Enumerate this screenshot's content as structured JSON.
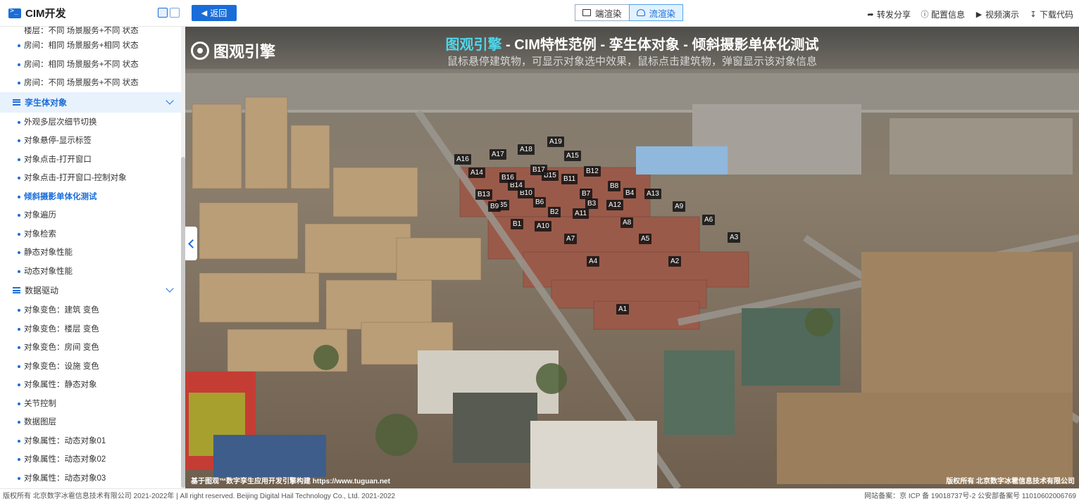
{
  "app": {
    "title": "CIM开发"
  },
  "header": {
    "back_label": "返回",
    "render_modes": [
      {
        "label": "端渲染",
        "icon": "monitor-icon",
        "active": false
      },
      {
        "label": "流渲染",
        "icon": "cloud-icon",
        "active": true
      }
    ],
    "tools": [
      {
        "label": "转发分享",
        "icon": "share-icon"
      },
      {
        "label": "配置信息",
        "icon": "info-icon"
      },
      {
        "label": "视频演示",
        "icon": "play-icon"
      },
      {
        "label": "下载代码",
        "icon": "download-icon"
      }
    ]
  },
  "sidebar": {
    "truncated_top": "楼层：不同 场景服务+不同 状态",
    "items_top": [
      "房间：相同 场景服务+相同 状态",
      "房间：相同 场景服务+不同 状态",
      "房间：不同 场景服务+不同 状态"
    ],
    "group1": {
      "label": "孪生体对象",
      "items": [
        "外观多层次细节切换",
        "对象悬停-显示标签",
        "对象点击-打开窗口",
        "对象点击-打开窗口-控制对象",
        "倾斜摄影单体化测试",
        "对象遍历",
        "对象检索",
        "静态对象性能",
        "动态对象性能"
      ],
      "active_index": 4
    },
    "group2": {
      "label": "数据驱动",
      "items": [
        "对象变色：建筑 变色",
        "对象变色：楼层 变色",
        "对象变色：房间 变色",
        "对象变色：设施 变色",
        "对象属性：静态对象",
        "关节控制",
        "数据图层",
        "对象属性：动态对象01",
        "对象属性：动态对象02",
        "对象属性：动态对象03"
      ]
    }
  },
  "viewport": {
    "logo_text": "图观引擎",
    "title_highlight": "图观引擎",
    "title_rest": " - CIM特性范例 - 孪生体对象 - 倾斜摄影单体化测试",
    "subtitle": "鼠标悬停建筑物，可显示对象选中效果，鼠标点击建筑物，弹窗显示该对象信息",
    "credit_left": "基于图观™数字孪生应用开发引擎构建 https://www.tuguan.net",
    "credit_right": "版权所有 北京数字冰雹信息技术有限公司",
    "building_labels": [
      "A1",
      "A2",
      "A3",
      "A4",
      "A5",
      "A6",
      "A7",
      "A8",
      "A9",
      "A10",
      "A11",
      "A12",
      "A13",
      "A14",
      "A15",
      "A16",
      "A17",
      "A18",
      "A19",
      "B1",
      "B2",
      "B3",
      "B4",
      "B5",
      "B6",
      "B7",
      "B8",
      "B9",
      "B10",
      "B11",
      "B12",
      "B13",
      "B14",
      "B15",
      "B16",
      "B17"
    ]
  },
  "footer": {
    "left": "版权所有 北京数字冰雹信息技术有限公司 2021-2022年 | All right reserved. Beijing Digital Hail Technology Co., Ltd. 2021-2022",
    "right": "网站备案：京 ICP 备 19018737号-2 公安部备案号 11010602006769"
  }
}
